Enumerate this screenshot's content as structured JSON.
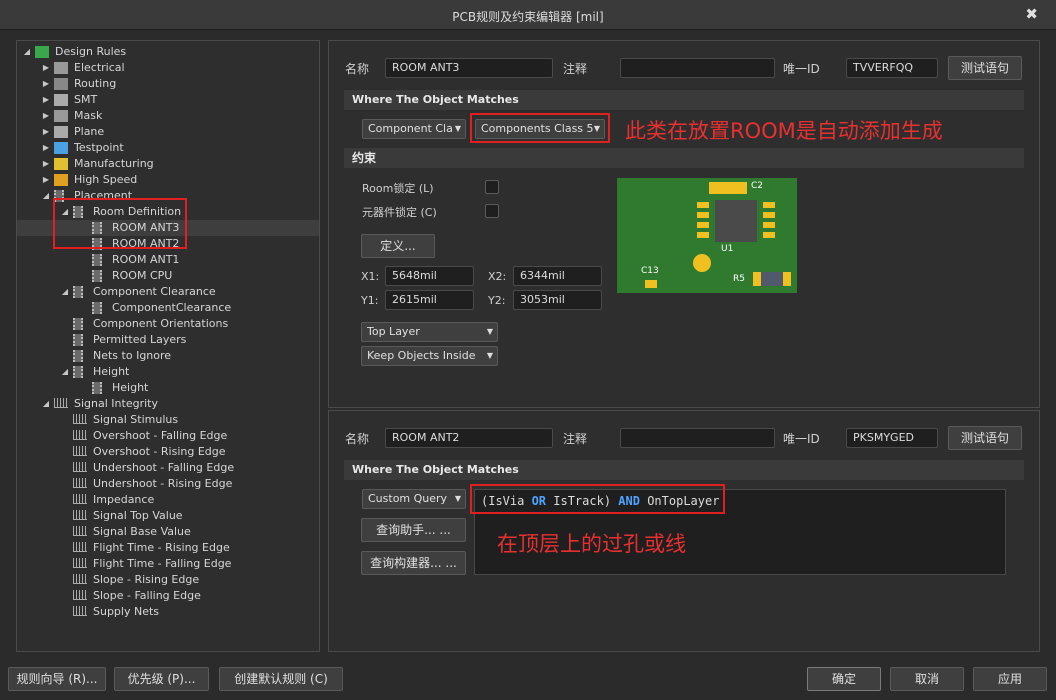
{
  "window": {
    "title": "PCB规则及约束编辑器 [mil]",
    "close_glyph": "✖"
  },
  "tree": [
    {
      "label": "Design Rules",
      "arrow": "◢",
      "icon": "rules-icon"
    },
    {
      "label": "Electrical",
      "arrow": "▶",
      "icon": "electrical-icon"
    },
    {
      "label": "Routing",
      "arrow": "▶",
      "icon": "routing-icon"
    },
    {
      "label": "SMT",
      "arrow": "▶",
      "icon": "smt-icon"
    },
    {
      "label": "Mask",
      "arrow": "▶",
      "icon": "mask-icon"
    },
    {
      "label": "Plane",
      "arrow": "▶",
      "icon": "plane-icon"
    },
    {
      "label": "Testpoint",
      "arrow": "▶",
      "icon": "testpoint-icon"
    },
    {
      "label": "Manufacturing",
      "arrow": "▶",
      "icon": "manufacturing-icon"
    },
    {
      "label": "High Speed",
      "arrow": "▶",
      "icon": "high-speed-icon"
    },
    {
      "label": "Placement",
      "arrow": "◢",
      "icon": "placement-icon"
    },
    {
      "label": "Room Definition",
      "arrow": "◢",
      "icon": "room-definition-icon"
    },
    {
      "label": "ROOM ANT3",
      "arrow": "",
      "icon": "rule-icon"
    },
    {
      "label": "ROOM ANT2",
      "arrow": "",
      "icon": "rule-icon"
    },
    {
      "label": "ROOM ANT1",
      "arrow": "",
      "icon": "rule-icon"
    },
    {
      "label": "ROOM CPU",
      "arrow": "",
      "icon": "rule-icon"
    },
    {
      "label": "Component Clearance",
      "arrow": "◢",
      "icon": "component-clearance-icon"
    },
    {
      "label": "ComponentClearance",
      "arrow": "",
      "icon": "rule-icon"
    },
    {
      "label": "Component Orientations",
      "arrow": "",
      "icon": "component-orientations-icon"
    },
    {
      "label": "Permitted Layers",
      "arrow": "",
      "icon": "permitted-layers-icon"
    },
    {
      "label": "Nets to Ignore",
      "arrow": "",
      "icon": "nets-to-ignore-icon"
    },
    {
      "label": "Height",
      "arrow": "◢",
      "icon": "height-icon"
    },
    {
      "label": "Height",
      "arrow": "",
      "icon": "rule-icon"
    },
    {
      "label": "Signal Integrity",
      "arrow": "◢",
      "icon": "signal-integrity-icon"
    },
    {
      "label": "Signal Stimulus",
      "arrow": "",
      "icon": "signal-icon"
    },
    {
      "label": "Overshoot - Falling Edge",
      "arrow": "",
      "icon": "signal-icon"
    },
    {
      "label": "Overshoot - Rising Edge",
      "arrow": "",
      "icon": "signal-icon"
    },
    {
      "label": "Undershoot - Falling Edge",
      "arrow": "",
      "icon": "signal-icon"
    },
    {
      "label": "Undershoot - Rising Edge",
      "arrow": "",
      "icon": "signal-icon"
    },
    {
      "label": "Impedance",
      "arrow": "",
      "icon": "signal-icon"
    },
    {
      "label": "Signal Top Value",
      "arrow": "",
      "icon": "signal-icon"
    },
    {
      "label": "Signal Base Value",
      "arrow": "",
      "icon": "signal-icon"
    },
    {
      "label": "Flight Time - Rising Edge",
      "arrow": "",
      "icon": "signal-icon"
    },
    {
      "label": "Flight Time - Falling Edge",
      "arrow": "",
      "icon": "signal-icon"
    },
    {
      "label": "Slope - Rising Edge",
      "arrow": "",
      "icon": "signal-icon"
    },
    {
      "label": "Slope - Falling Edge",
      "arrow": "",
      "icon": "signal-icon"
    },
    {
      "label": "Supply Nets",
      "arrow": "",
      "icon": "signal-icon"
    }
  ],
  "rule1": {
    "name_label": "名称",
    "name": "ROOM ANT3",
    "comment_label": "注释",
    "comment": "",
    "uid_label": "唯一ID",
    "uid": "TVVERFQQ",
    "test_button": "测试语句",
    "where_header": "Where The Object Matches",
    "match_kind": "Component Cla",
    "match_value": "Components Class 5",
    "annotation": "此类在放置ROOM是自动添加生成",
    "constraints_header": "约束",
    "room_lock": "Room锁定 (L)",
    "component_lock": "元器件锁定 (C)",
    "define_button": "定义...",
    "x1_label": "X1:",
    "x1": "5648mil",
    "x2_label": "X2:",
    "x2": "6344mil",
    "y1_label": "Y1:",
    "y1": "2615mil",
    "y2_label": "Y2:",
    "y2": "3053mil",
    "layer": "Top Layer",
    "keep_mode": "Keep Objects Inside",
    "pcb_labels": {
      "c2": "C2",
      "u1": "U1",
      "c13": "C13",
      "r5": "R5"
    }
  },
  "rule2": {
    "name_label": "名称",
    "name": "ROOM ANT2",
    "comment_label": "注释",
    "comment": "",
    "uid_label": "唯一ID",
    "uid": "PKSMYGED",
    "test_button": "测试语句",
    "where_header": "Where The Object Matches",
    "match_kind": "Custom Query",
    "query_open": "(IsVia ",
    "query_or": "OR",
    "query_mid": " IsTrack) ",
    "query_and": "AND",
    "query_end": " OnTopLayer",
    "helper_button": "查询助手... ...",
    "builder_button": "查询构建器... ...",
    "annotation": "在顶层上的过孔或线"
  },
  "footer": {
    "wizard": "规则向导 (R)...",
    "priority": "优先级 (P)...",
    "create_default": "创建默认规则 (C)",
    "ok": "确定",
    "cancel": "取消",
    "apply": "应用"
  },
  "colors": {
    "annotation_red": "#e02020",
    "keyword_blue": "#4da3ff",
    "pcb_green": "#2f7a2f",
    "pad_gold": "#f0c020"
  }
}
